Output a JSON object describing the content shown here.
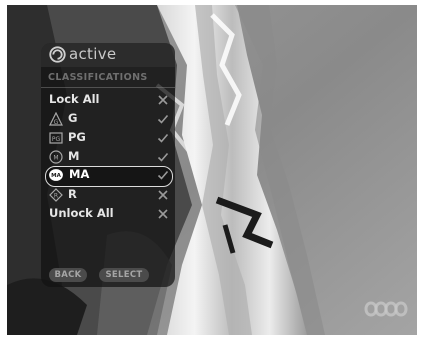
{
  "brand": {
    "name": "active",
    "logo_icon": "abc-active-logo-icon"
  },
  "section": {
    "title": "CLASSIFICATIONS"
  },
  "items": [
    {
      "label": "Lock All",
      "icon": "",
      "state": "cross"
    },
    {
      "label": "G",
      "icon": "rating-g-icon",
      "state": "check"
    },
    {
      "label": "PG",
      "icon": "rating-pg-icon",
      "state": "check"
    },
    {
      "label": "M",
      "icon": "rating-m-icon",
      "state": "check"
    },
    {
      "label": "MA",
      "icon": "rating-ma-icon",
      "state": "check",
      "selected": true
    },
    {
      "label": "R",
      "icon": "rating-r-icon",
      "state": "cross"
    },
    {
      "label": "Unlock All",
      "icon": "",
      "state": "cross"
    }
  ],
  "buttons": {
    "back": "BACK",
    "select": "SELECT"
  },
  "watermark": {
    "icon": "abc-watermark-icon"
  },
  "colors": {
    "panel": "#121212",
    "text": "#e6e6e6",
    "muted": "#6f6f6f"
  }
}
